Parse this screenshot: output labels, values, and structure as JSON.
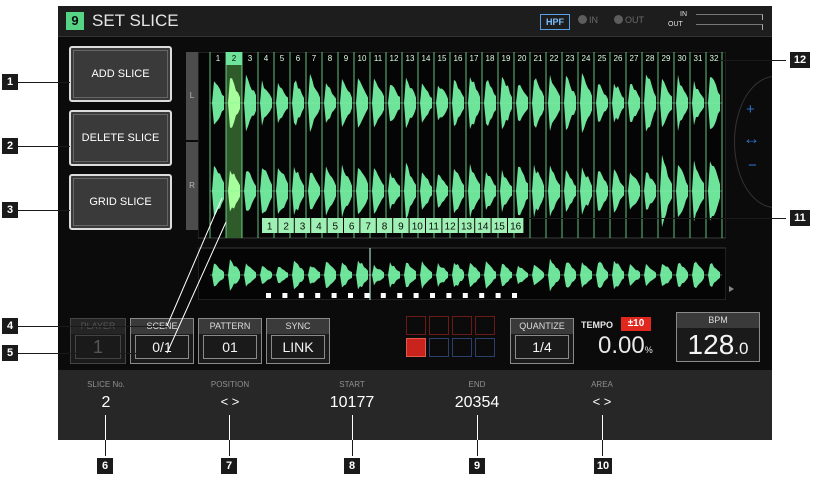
{
  "header": {
    "screen_number": "9",
    "title": "SET SLICE",
    "hpf_label": "HPF",
    "in_label": "IN",
    "out_label": "OUT",
    "level_in_label": "IN",
    "level_out_label": "OUT"
  },
  "side_buttons": [
    {
      "label": "ADD SLICE"
    },
    {
      "label": "DELETE SLICE"
    },
    {
      "label": "GRID SLICE"
    }
  ],
  "channel_labels": {
    "left": "L",
    "right": "R"
  },
  "top_slice_numbers": [
    "1",
    "2",
    "3",
    "4",
    "5",
    "6",
    "7",
    "8",
    "9",
    "10",
    "11",
    "12",
    "13",
    "14",
    "15",
    "16",
    "17",
    "18",
    "19",
    "20",
    "21",
    "22",
    "23",
    "24",
    "25",
    "26",
    "27",
    "28",
    "29",
    "30",
    "31",
    "32"
  ],
  "pad_slice_numbers": [
    "1",
    "2",
    "3",
    "4",
    "5",
    "6",
    "7",
    "8",
    "9",
    "10",
    "11",
    "12",
    "13",
    "14",
    "15",
    "16"
  ],
  "selected_slice": 2,
  "jog": {
    "plus": "+",
    "minus": "−",
    "arrows": "↔"
  },
  "controls": {
    "player_label": "PLAYER",
    "player_value": "1",
    "scene_label": "SCENE",
    "scene_value": "0/1",
    "pattern_label": "PATTERN",
    "pattern_value": "01",
    "sync_label": "SYNC",
    "sync_value": "LINK",
    "quantize_label": "QUANTIZE",
    "quantize_value": "1/4",
    "tempo_label": "TEMPO",
    "tempo_range": "±10",
    "tempo_value": "0.00",
    "tempo_unit": "%",
    "bpm_label": "BPM",
    "bpm_value": "128",
    "bpm_decimal": ".0"
  },
  "pattern_pads": {
    "rows": 2,
    "cols": 4,
    "active_index": 4
  },
  "fields": {
    "slice_no_label": "SLICE No.",
    "slice_no_value": "2",
    "position_label": "POSITION",
    "position_value": "< >",
    "start_label": "START",
    "start_value": "10177",
    "end_label": "END",
    "end_value": "20354",
    "area_label": "AREA",
    "area_value": "< >"
  },
  "callouts": [
    "1",
    "2",
    "3",
    "4",
    "5",
    "6",
    "7",
    "8",
    "9",
    "10",
    "11",
    "12"
  ],
  "colors": {
    "waveform": "#6ee39a",
    "waveform_selected": "#a6ff9c",
    "grid_line": "#7cf0a0",
    "accent_red": "#e0281e",
    "pad_red": "#c8231c"
  }
}
